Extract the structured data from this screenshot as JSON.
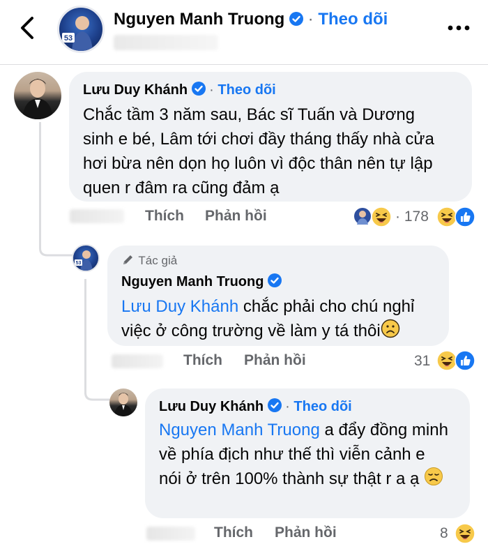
{
  "header": {
    "name": "Nguyen Manh Truong",
    "separator": "·",
    "follow_label": "Theo dõi",
    "avatar_badge": "53"
  },
  "comments": [
    {
      "author": "Lưu Duy Khánh",
      "separator": "·",
      "follow_label": "Theo dõi",
      "text": "Chắc tầm 3 năm sau, Bác sĩ Tuấn và Dương sinh e bé, Lâm tới chơi đầy tháng thấy nhà cửa hơi bừa nên dọn họ luôn vì độc thân nên tự lập quen r đâm ra cũng đảm ạ",
      "like_label": "Thích",
      "reply_label": "Phản hồi",
      "reaction_separator": "·",
      "reaction_count": "178"
    },
    {
      "author_tag": "Tác giả",
      "author": "Nguyen Manh Truong",
      "mention": "Lưu Duy Khánh",
      "text": " chắc phải cho chú nghỉ việc ở công trường về làm y tá thôi",
      "like_label": "Thích",
      "reply_label": "Phản hồi",
      "reaction_count": "31",
      "avatar_badge": "53"
    },
    {
      "author": "Lưu Duy Khánh",
      "separator": "·",
      "follow_label": "Theo dõi",
      "mention": "Nguyen Manh Truong",
      "text": " a đẩy đồng minh về phía địch như thế thì viễn cảnh e nói ở trên 100% thành sự thật r a ạ",
      "like_label": "Thích",
      "reply_label": "Phản hồi",
      "reaction_count": "8"
    }
  ],
  "icons": {
    "back": "chevron-left-icon",
    "more": "more-horizontal-icon",
    "verified": "verified-badge-icon",
    "pencil": "pencil-icon",
    "haha": "haha-reaction-icon",
    "like": "like-reaction-icon",
    "frown": "frowning-emoji-icon",
    "disappointed": "disappointed-emoji-icon"
  },
  "colors": {
    "accent": "#1877f2",
    "secondary_text": "#65676b",
    "bubble": "#f0f2f5",
    "haha_yellow": "#f7c94a"
  }
}
